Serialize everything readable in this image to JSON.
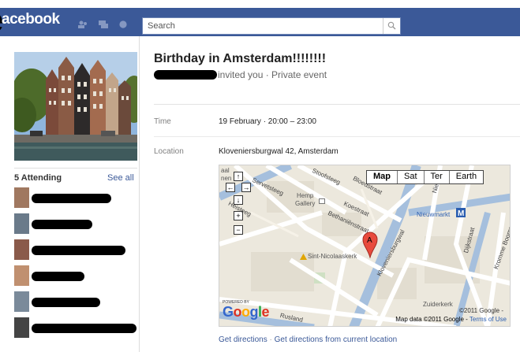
{
  "header": {
    "logo": "acebook",
    "logo_fragment": "e",
    "search_placeholder": "Search"
  },
  "sidebar": {
    "attending_label": "5 Attending",
    "see_all": "See all",
    "attendees": [
      {
        "name_bar_width": 0.72
      },
      {
        "name_bar_width": 0.55
      },
      {
        "name_bar_width": 0.85
      },
      {
        "name_bar_width": 0.48
      },
      {
        "name_bar_width": 0.62
      },
      {
        "name_bar_width": 0.95
      }
    ]
  },
  "event": {
    "title": "Birthday in Amsterdam!!!!!!!!",
    "invite_text": "invited you · Private event",
    "time_label": "Time",
    "time_value": "19 February · 20:00 – 23:00",
    "location_label": "Location",
    "location_value": "Kloveniersburgwal 42, Amsterdam"
  },
  "map": {
    "types": [
      "Map",
      "Sat",
      "Ter",
      "Earth"
    ],
    "active_type": "Map",
    "labels": {
      "hemp_gallery": "Hemp",
      "hemp_gallery2": "Gallery",
      "nieuwmarkt": "Nieuwmarkt",
      "sint_nicolaas": "Sint-Nicolaaskerk",
      "zuiderkerk": "Zuiderkerk",
      "aal": "aal",
      "nen": "nen"
    },
    "streets": {
      "s1": "Servetsteeg",
      "s2": "Stoofsteeg",
      "s3": "Bloedstraat",
      "s4": "Koestraat",
      "s5": "Bethaniënstraat",
      "s6": "Kloveniersburgwal",
      "s7": "Nieuwe",
      "s8": "Keizerstraat",
      "s9": "Kromme Boomssloot",
      "s10": "Rusland",
      "s11": "Dijkstraat",
      "s12": "Stormsteeg",
      "s13": "Heisteeg",
      "s14": "Lijnbaanssteeg"
    },
    "marker_letter": "A",
    "powered_by": "POWERED BY",
    "google": "Google",
    "copyright": "©2011 Google -",
    "attribution": "Map data ©2011 Google -",
    "terms": "Terms of Use"
  },
  "directions": {
    "get_directions": "Get directions",
    "separator": "·",
    "from_current": "Get directions from current location"
  },
  "colors": {
    "brand": "#3b5998",
    "link": "#3b5998",
    "water": "#a5bfdd",
    "marker": "#e84a3c"
  }
}
